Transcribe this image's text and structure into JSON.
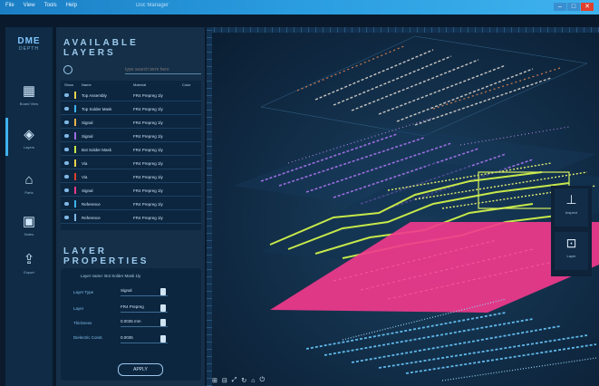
{
  "menu": [
    "File",
    "View",
    "Tools",
    "Help"
  ],
  "window_title": "Doc Manager",
  "brand": {
    "logo": "DME",
    "sub": "DEPTH"
  },
  "nav": [
    {
      "icon": "board-icon",
      "glyph": "▦",
      "label": "Board View"
    },
    {
      "icon": "layers-icon",
      "glyph": "◈",
      "label": "Layers"
    },
    {
      "icon": "component-icon",
      "glyph": "⌂",
      "label": "Parts"
    },
    {
      "icon": "clipboard-icon",
      "glyph": "▣",
      "label": "Notes"
    },
    {
      "icon": "export-icon",
      "glyph": "⇪",
      "label": "Export"
    }
  ],
  "layers_panel": {
    "title_line1": "AVAILABLE",
    "title_line2": "LAYERS",
    "search_placeholder": "type search term here",
    "columns": [
      "Show",
      "Name",
      "Material",
      "Color"
    ],
    "rows": [
      {
        "name": "Top Assembly",
        "material": "FR4 Prepreg 1ly",
        "color": "#e8d24a"
      },
      {
        "name": "Top Solder Mask",
        "material": "FR4 Prepreg 1ly",
        "color": "#3fb2ee"
      },
      {
        "name": "Signal",
        "material": "FR4 Prepreg 1ly",
        "color": "#e8b44a"
      },
      {
        "name": "Signal",
        "material": "FR4 Prepreg 1ly",
        "color": "#9b6ee0"
      },
      {
        "name": "Bot Solder Mask",
        "material": "FR4 Prepreg 1ly",
        "color": "#c7e84a"
      },
      {
        "name": "Via",
        "material": "FR4 Prepreg 1ly",
        "color": "#e8d24a"
      },
      {
        "name": "Via",
        "material": "FR4 Prepreg 1ly",
        "color": "#e0412c"
      },
      {
        "name": "Signal",
        "material": "FR4 Prepreg 1ly",
        "color": "#f03a8c"
      },
      {
        "name": "Reference",
        "material": "FR4 Prepreg 1ly",
        "color": "#3fb2ee"
      },
      {
        "name": "Reference",
        "material": "FR4 Prepreg 1ly",
        "color": "#7fb8e6"
      }
    ]
  },
  "properties_panel": {
    "title_line1": "LAYER",
    "title_line2": "PROPERTIES",
    "caption": "Layer name: Bot Solder Mask 1ly",
    "fields": [
      {
        "label": "Layer Type",
        "value": "Signal"
      },
      {
        "label": "Layer",
        "value": "FR4 Prepreg"
      },
      {
        "label": "Thickness",
        "value": "0.0035 mm"
      },
      {
        "label": "Dielectric Const.",
        "value": "0.0035"
      }
    ],
    "apply_label": "APPLY"
  },
  "side_tools": [
    {
      "icon": "inspect-icon",
      "glyph": "⊥",
      "label": "Inspect"
    },
    {
      "icon": "package-icon",
      "glyph": "⊡",
      "label": "Layer"
    }
  ],
  "bottom_tools": [
    "⊞",
    "⊟",
    "⤢",
    "↻",
    "⌂",
    "⏻"
  ],
  "colors": {
    "accent": "#3fb2ee",
    "magenta_layer": "#f03a8c",
    "green_layer": "#c7e84a",
    "purple_layer": "#9b6ee0"
  }
}
